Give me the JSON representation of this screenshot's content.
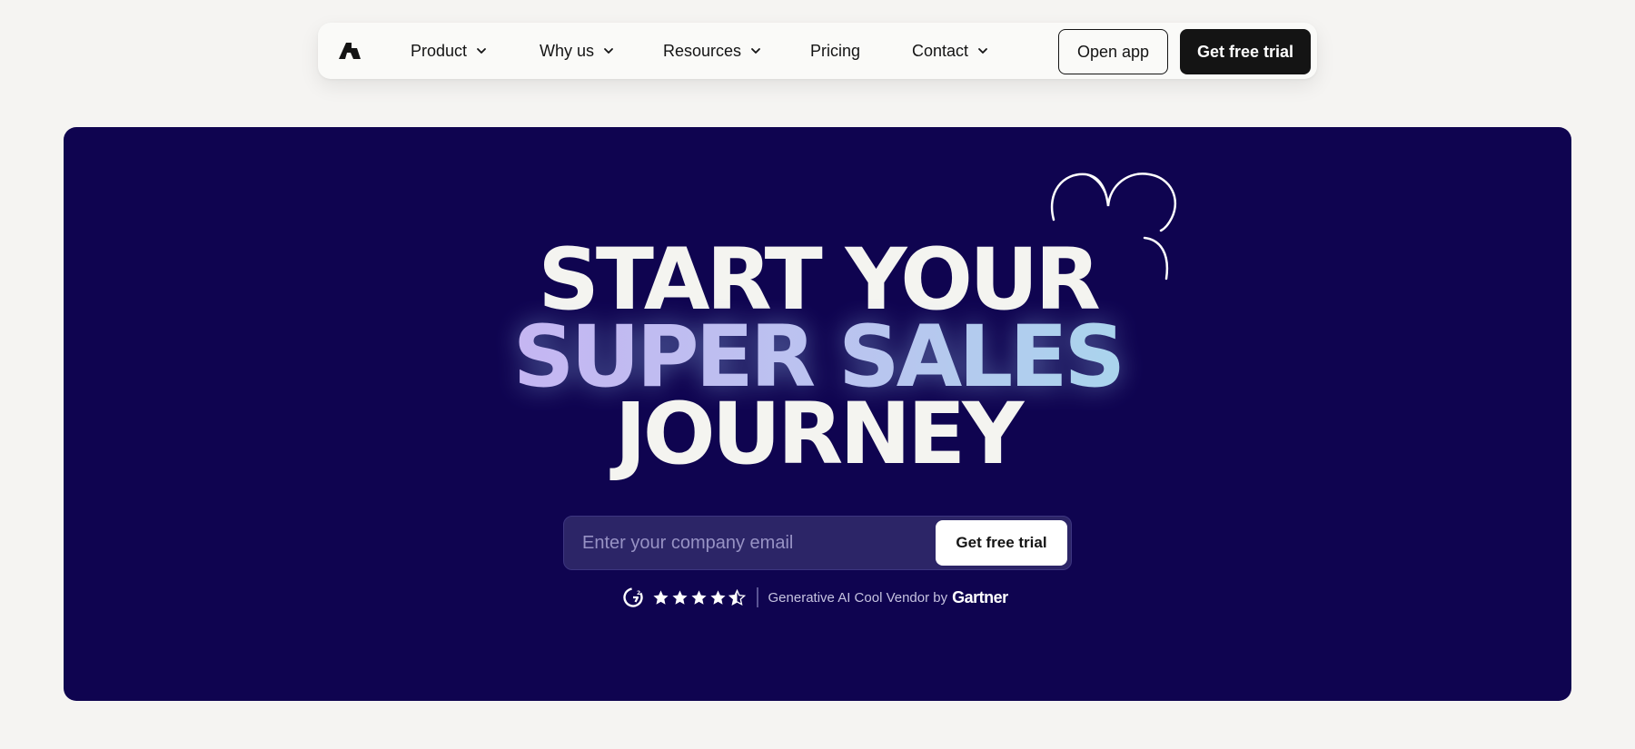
{
  "nav": {
    "logo_icon": "brand-logo-icon",
    "items": [
      {
        "label": "Product",
        "dropdown": true
      },
      {
        "label": "Why us",
        "dropdown": true
      },
      {
        "label": "Resources",
        "dropdown": true
      },
      {
        "label": "Pricing",
        "dropdown": false
      },
      {
        "label": "Contact",
        "dropdown": true
      }
    ],
    "open_app_label": "Open app",
    "trial_label": "Get free trial"
  },
  "hero": {
    "headline_line1": "START YOUR",
    "headline_line2": "SUPER SALES",
    "headline_line3": "JOURNEY",
    "email_placeholder": "Enter your company email",
    "email_value": "",
    "cta_label": "Get free trial",
    "rating": {
      "g2_icon": "g2-logo-icon",
      "stars": 4.5,
      "vendor_text": "Generative AI Cool Vendor by",
      "vendor_brand": "Gartner"
    }
  },
  "colors": {
    "hero_background": "#0f0450",
    "page_background": "#f5f4f2",
    "primary_button": "#141414",
    "headline_white": "#f4f4f0",
    "gradient_purple": "#c5b6f2",
    "gradient_teal": "#8ef0e8"
  }
}
